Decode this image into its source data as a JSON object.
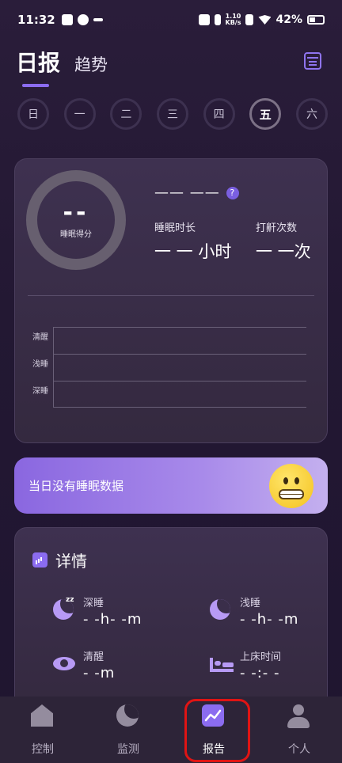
{
  "status_bar": {
    "time": "11:32",
    "net_speed_top": "1.10",
    "net_speed_bottom": "KB/s",
    "battery": "42%"
  },
  "header": {
    "tab_daily": "日报",
    "tab_trend": "趋势",
    "calendar_icon": "calendar-icon"
  },
  "days": [
    "日",
    "一",
    "二",
    "三",
    "四",
    "五",
    "六"
  ],
  "selected_day": "五",
  "sleep_card": {
    "score_value": "--",
    "score_label": "睡眠得分",
    "time_range": "—— ——",
    "help": "?",
    "duration_label": "睡眠时长",
    "duration_value": "一 一 小时",
    "snore_label": "打鼾次数",
    "snore_value": "一 一次",
    "stages": [
      "清醒",
      "浅睡",
      "深睡"
    ]
  },
  "banner": {
    "text": "当日没有睡眠数据",
    "emoji": "grimacing-face-emoji"
  },
  "details": {
    "title": "详情",
    "deep_label": "深睡",
    "deep_value": "- -h- -m",
    "light_label": "浅睡",
    "light_value": "- -h- -m",
    "awake_label": "清醒",
    "awake_value": "- -m",
    "bedtime_label": "上床时间",
    "bedtime_value": "- -:- -"
  },
  "nav": {
    "control": "控制",
    "monitor": "监测",
    "report": "报告",
    "profile": "个人"
  },
  "colors": {
    "accent": "#8b6cf0",
    "highlight": "#e01414"
  }
}
